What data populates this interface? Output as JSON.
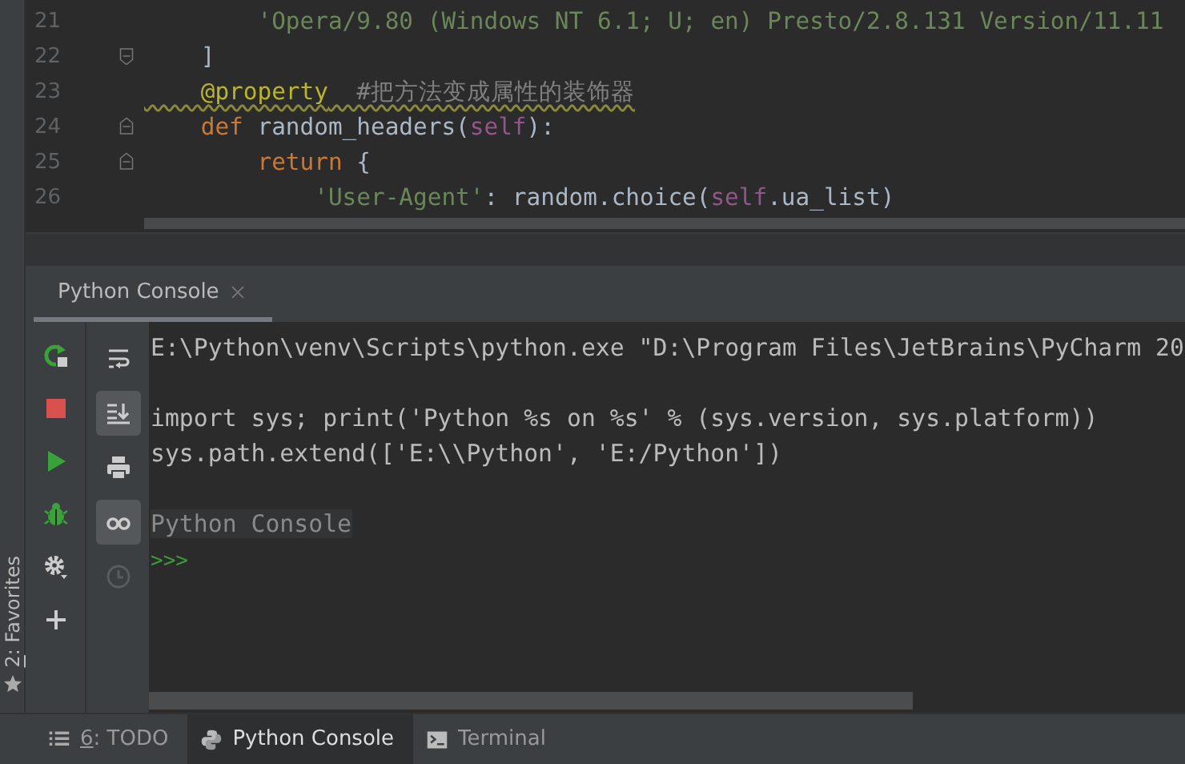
{
  "editor": {
    "lines": [
      {
        "number": "21",
        "fold_start": false,
        "fold_end": false,
        "warning": false,
        "tokens": [
          {
            "kind": "string",
            "text": "        'Opera/9.80 (Windows NT 6.1; U; en) Presto/2.8.131 Version/11.11"
          }
        ]
      },
      {
        "number": "22",
        "fold_start": false,
        "fold_end": true,
        "warning": false,
        "tokens": [
          {
            "kind": "plain",
            "text": "    ]"
          }
        ]
      },
      {
        "number": "23",
        "fold_start": false,
        "fold_end": false,
        "warning": true,
        "tokens": [
          {
            "kind": "decorator",
            "text": "    @property"
          },
          {
            "kind": "comment",
            "text": "  #把方法变成属性的装饰器"
          }
        ]
      },
      {
        "number": "24",
        "fold_start": true,
        "fold_end": false,
        "warning": false,
        "tokens": [
          {
            "kind": "keyword",
            "text": "    def"
          },
          {
            "kind": "plain",
            "text": " random_headers("
          },
          {
            "kind": "self",
            "text": "self"
          },
          {
            "kind": "plain",
            "text": "):"
          }
        ]
      },
      {
        "number": "25",
        "fold_start": true,
        "fold_end": false,
        "warning": false,
        "tokens": [
          {
            "kind": "keyword",
            "text": "        return"
          },
          {
            "kind": "plain",
            "text": " {"
          }
        ]
      },
      {
        "number": "26",
        "fold_start": false,
        "fold_end": false,
        "warning": false,
        "tokens": [
          {
            "kind": "string",
            "text": "            'User-Agent'"
          },
          {
            "kind": "plain",
            "text": ": random.choice("
          },
          {
            "kind": "self",
            "text": "self"
          },
          {
            "kind": "plain",
            "text": ".ua_list)"
          }
        ]
      }
    ]
  },
  "tool_window": {
    "tab": {
      "label": "Python Console",
      "selected": true
    },
    "run_toolbar": [
      {
        "kind": "rerun"
      },
      {
        "kind": "stop"
      },
      {
        "kind": "run"
      },
      {
        "kind": "debug"
      },
      {
        "kind": "settings"
      },
      {
        "kind": "add"
      }
    ],
    "view_toolbar": [
      {
        "kind": "wrap",
        "on": false,
        "disabled": false
      },
      {
        "kind": "scroll-end",
        "on": true,
        "disabled": false
      },
      {
        "kind": "print",
        "on": false,
        "disabled": false
      },
      {
        "kind": "glasses",
        "on": true,
        "disabled": false
      },
      {
        "kind": "history",
        "on": false,
        "disabled": true
      }
    ],
    "console_blocks": [
      {
        "lines": [
          {
            "kind": "output",
            "text": "E:\\Python\\venv\\Scripts\\python.exe \"D:\\Program Files\\JetBrains\\PyCharm 20"
          }
        ]
      },
      {
        "lines": [
          {
            "kind": "output",
            "text": "import sys; print('Python %s on %s' % (sys.version, sys.platform))"
          },
          {
            "kind": "output",
            "text": "sys.path.extend(['E:\\\\Python', 'E:/Python'])"
          }
        ]
      },
      {
        "lines": [
          {
            "kind": "banner",
            "text": "Python Console"
          },
          {
            "kind": "prompt",
            "text": ">>>"
          }
        ]
      }
    ]
  },
  "side_stripe": {
    "shortcut": "2",
    "label": ": Favorites"
  },
  "bottom_tabs": [
    {
      "kind": "todo",
      "shortcut": "6",
      "label": ": TODO",
      "selected": false
    },
    {
      "kind": "python",
      "label": "Python Console",
      "selected": true
    },
    {
      "kind": "terminal",
      "label": "Terminal",
      "selected": false
    }
  ]
}
